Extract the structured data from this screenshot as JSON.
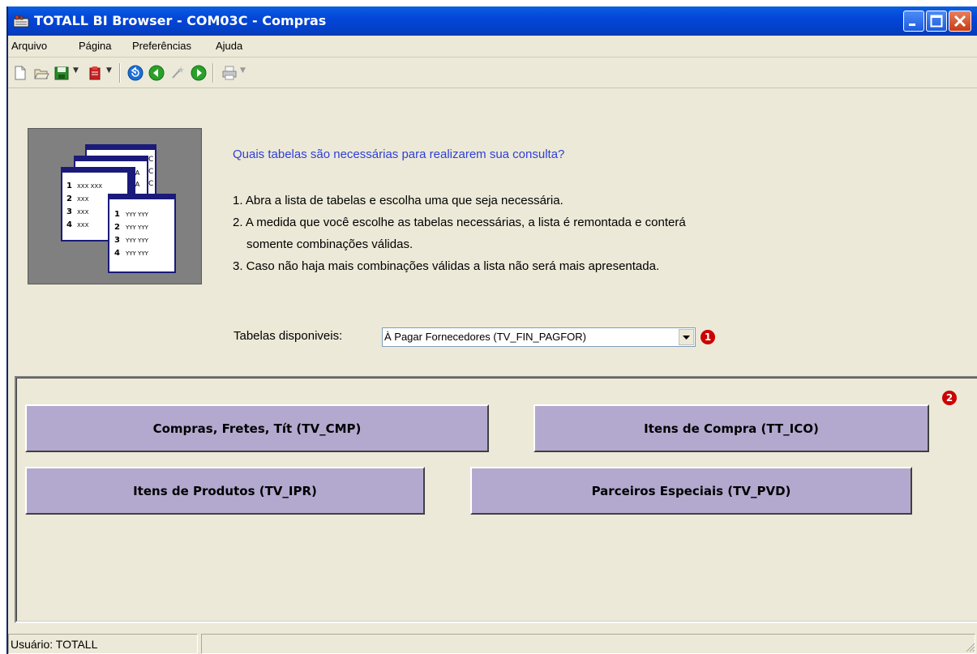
{
  "window": {
    "title": "TOTALL BI Browser - COM03C - Compras",
    "colors": {
      "titlebar": "#0346d8",
      "face": "#ece9d8",
      "accent_text": "#2f3fd6",
      "table_button": "#b3a9cf",
      "badge": "#cc0000"
    }
  },
  "menu": {
    "items": [
      {
        "label": "Arquivo"
      },
      {
        "label": "Página"
      },
      {
        "label": "Preferências"
      },
      {
        "label": "Ajuda"
      }
    ]
  },
  "toolbar": {
    "icons": [
      "new-document-icon",
      "open-folder-icon",
      "save-icon",
      "bookmark-icon",
      "refresh-icon",
      "back-icon",
      "wand-icon",
      "forward-icon",
      "print-icon"
    ]
  },
  "content": {
    "question": "Quais tabelas são necessárias para realizarem sua consulta?",
    "steps": [
      "1. Abra a lista de tabelas e escolha uma que seja necessária.",
      "2. A medida que você escolhe as tabelas necessárias, a lista é remontada e conterá",
      "somente combinações válidas.",
      "3. Caso não haja mais combinações válidas a lista não será mais apresentada."
    ],
    "select_label": "Tabelas disponiveis:",
    "select_value": "À Pagar Fornecedores (TV_FIN_PAGFOR)",
    "badge1": "1",
    "badge2": "2"
  },
  "tables": [
    {
      "label": "Compras, Fretes, Tít (TV_CMP)"
    },
    {
      "label": "Itens de Compra (TT_ICO)"
    },
    {
      "label": "Itens de Produtos (TV_IPR)"
    },
    {
      "label": "Parceiros Especiais (TV_PVD)"
    }
  ],
  "status": {
    "user": "Usuário: TOTALL"
  }
}
